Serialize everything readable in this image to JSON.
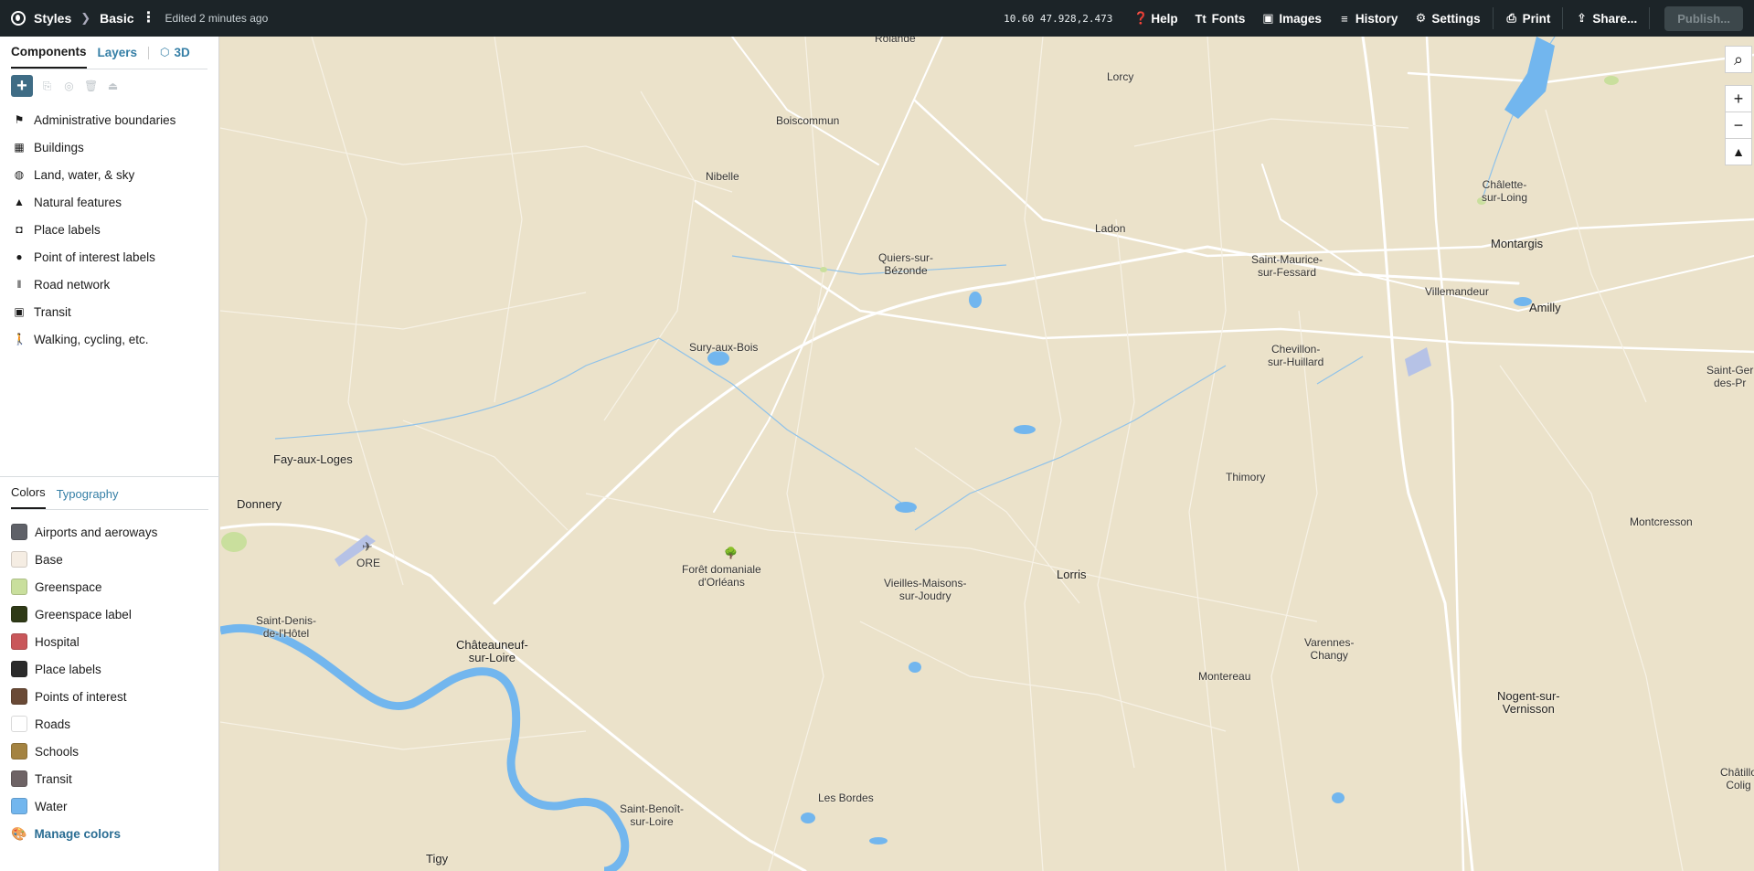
{
  "header": {
    "breadcrumb_root": "Styles",
    "breadcrumb_current": "Basic",
    "edited": "Edited 2 minutes ago",
    "zoom": "10.60",
    "center": "47.928,2.473",
    "help": "Help",
    "fonts": "Fonts",
    "images": "Images",
    "history": "History",
    "settings": "Settings",
    "print": "Print",
    "share": "Share...",
    "publish": "Publish..."
  },
  "panel": {
    "tabs": {
      "components": "Components",
      "layers": "Layers",
      "three_d": "3D"
    },
    "components": [
      {
        "label": "Administrative boundaries",
        "icon": "flag-icon"
      },
      {
        "label": "Buildings",
        "icon": "building-icon"
      },
      {
        "label": "Land, water, & sky",
        "icon": "globe-icon"
      },
      {
        "label": "Natural features",
        "icon": "mountain-icon"
      },
      {
        "label": "Place labels",
        "icon": "place-label-icon"
      },
      {
        "label": "Point of interest labels",
        "icon": "pin-icon"
      },
      {
        "label": "Road network",
        "icon": "road-icon"
      },
      {
        "label": "Transit",
        "icon": "bus-icon"
      },
      {
        "label": "Walking, cycling, etc.",
        "icon": "walking-icon"
      }
    ],
    "lower_tabs": {
      "colors": "Colors",
      "typography": "Typography"
    },
    "colors": [
      {
        "label": "Airports and aeroways",
        "color": "#5f6168"
      },
      {
        "label": "Base",
        "color": "#f5ede3"
      },
      {
        "label": "Greenspace",
        "color": "#c9df9d"
      },
      {
        "label": "Greenspace label",
        "color": "#2f3a17"
      },
      {
        "label": "Hospital",
        "color": "#c9575a"
      },
      {
        "label": "Place labels",
        "color": "#2b2b2b"
      },
      {
        "label": "Points of interest",
        "color": "#6a4a36"
      },
      {
        "label": "Roads",
        "color": "#ffffff"
      },
      {
        "label": "Schools",
        "color": "#a48341"
      },
      {
        "label": "Transit",
        "color": "#6e6365"
      },
      {
        "label": "Water",
        "color": "#72b6ee"
      }
    ],
    "manage_colors": "Manage colors"
  },
  "map": {
    "places": [
      {
        "name": "Rolande"
      },
      {
        "name": "Lorcy"
      },
      {
        "name": "Boiscommun"
      },
      {
        "name": "Nibelle"
      },
      {
        "name": "Ladon"
      },
      {
        "name": "Quiers-sur-\nBézonde"
      },
      {
        "name": "Saint-Maurice-\nsur-Fessard"
      },
      {
        "name": "Châlette-\nsur-Loing"
      },
      {
        "name": "Montargis"
      },
      {
        "name": "Villemandeur"
      },
      {
        "name": "Amilly"
      },
      {
        "name": "Sury-aux-Bois"
      },
      {
        "name": "Chevillon-\nsur-Huillard"
      },
      {
        "name": "Saint-Ger\ndes-Pr"
      },
      {
        "name": "Fay-aux-Loges"
      },
      {
        "name": "Thimory"
      },
      {
        "name": "Donnery"
      },
      {
        "name": "Montcresson"
      },
      {
        "name": "ORE"
      },
      {
        "name": "Forêt domaniale\nd'Orléans"
      },
      {
        "name": "Vieilles-Maisons-\nsur-Joudry"
      },
      {
        "name": "Lorris"
      },
      {
        "name": "Saint-Denis-\nde-l'Hôtel"
      },
      {
        "name": "Châteauneuf-\nsur-Loire"
      },
      {
        "name": "Varennes-\nChangy"
      },
      {
        "name": "Montereau"
      },
      {
        "name": "Nogent-sur-\nVernisson"
      },
      {
        "name": "Les Bordes"
      },
      {
        "name": "Saint-Benoît-\nsur-Loire"
      },
      {
        "name": "Châtillo\nColig"
      },
      {
        "name": "Tigy"
      }
    ]
  }
}
